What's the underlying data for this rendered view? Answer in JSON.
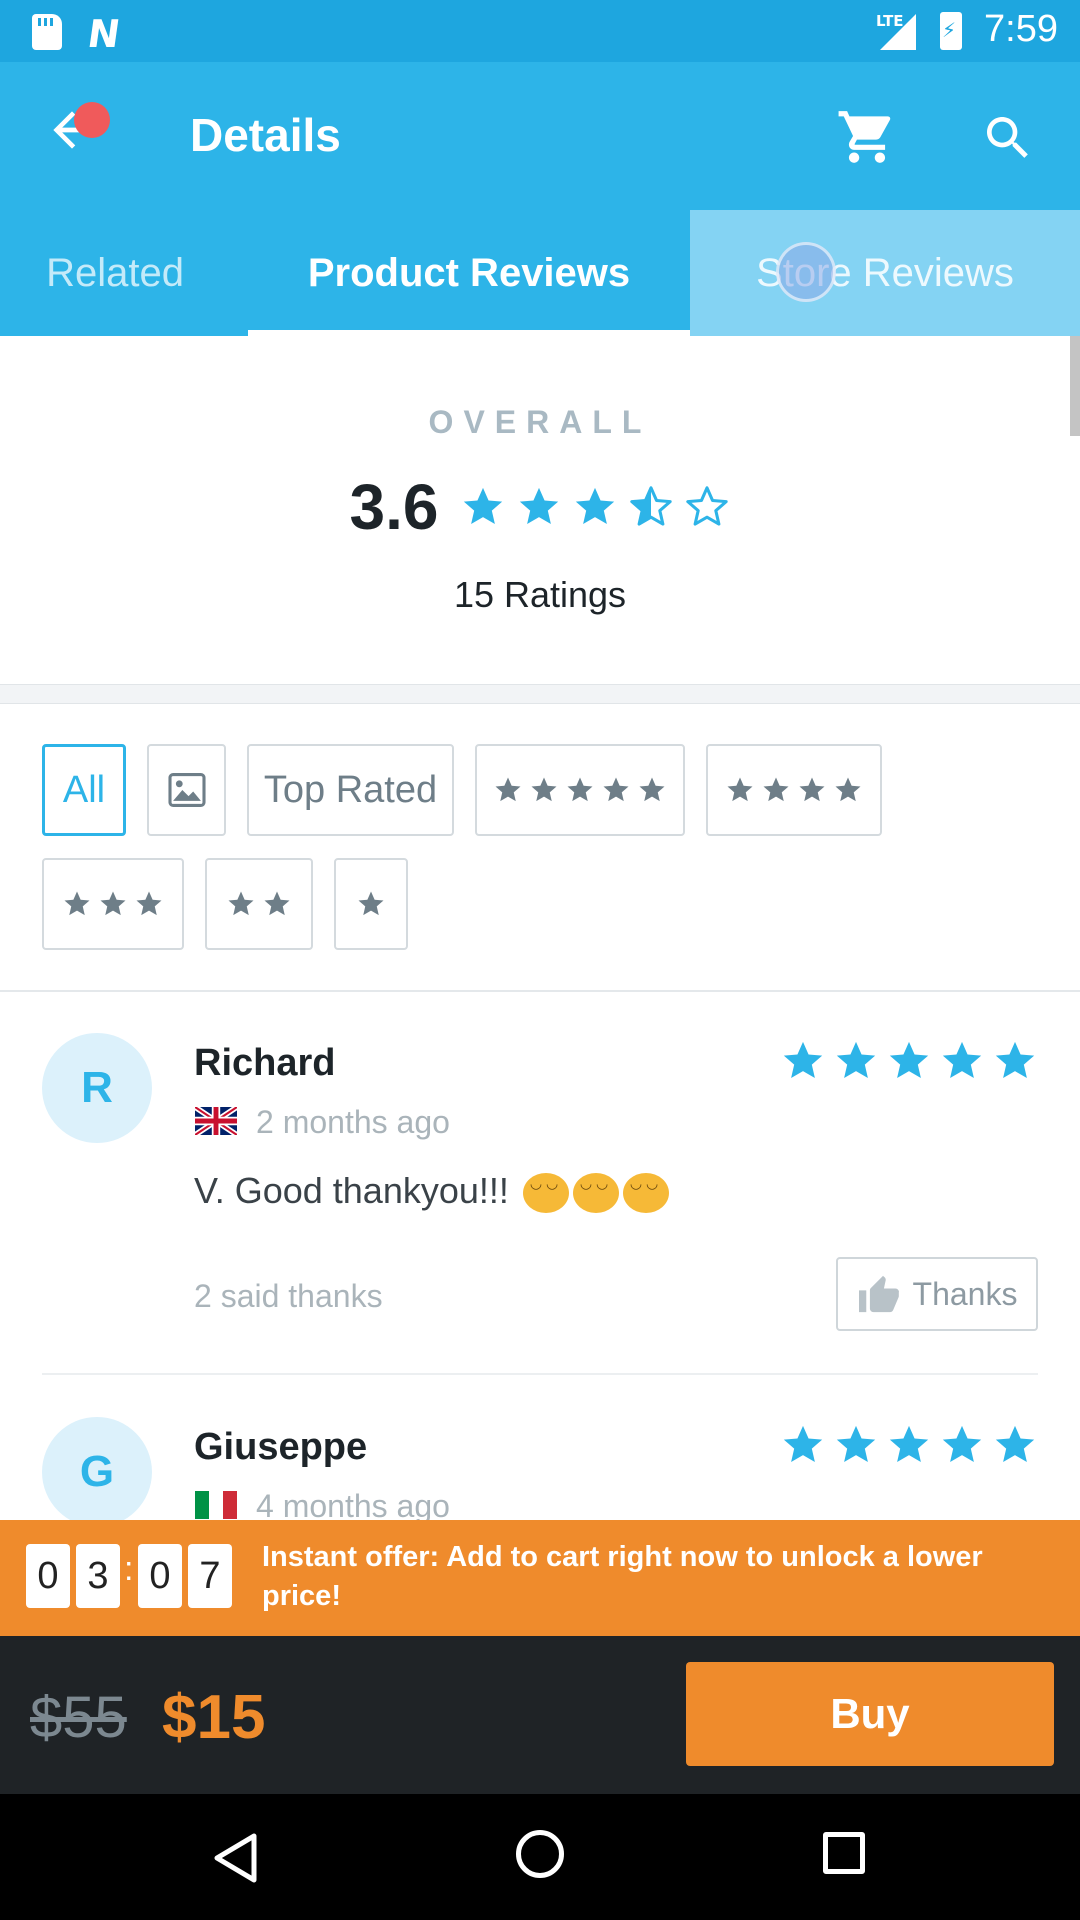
{
  "status_bar": {
    "network": "LTE",
    "time": "7:59"
  },
  "app_bar": {
    "title": "Details"
  },
  "tabs": [
    {
      "label": "Related",
      "active": false
    },
    {
      "label": "Product Reviews",
      "active": true
    },
    {
      "label": "Store Reviews",
      "active": false
    }
  ],
  "overall": {
    "label": "OVERALL",
    "score": "3.6",
    "stars": 3.5,
    "ratings_count": "15 Ratings"
  },
  "filters": {
    "all": "All",
    "image_icon": "image-icon",
    "top_rated": "Top Rated",
    "star_filters": [
      5,
      4,
      3,
      2,
      1
    ]
  },
  "reviews": [
    {
      "initial": "R",
      "name": "Richard",
      "stars": 5,
      "country_flag": "uk-flag-icon",
      "date": "2 months ago",
      "text": "V. Good thankyou!!!",
      "emoji_count": 3,
      "thanks_count": "2 said thanks",
      "thanks_label": "Thanks"
    },
    {
      "initial": "G",
      "name": "Giuseppe",
      "stars": 5,
      "country_flag": "italy-flag-icon",
      "date": "4 months ago"
    }
  ],
  "offer": {
    "timer": [
      "0",
      "3",
      "0",
      "7"
    ],
    "separator": ":",
    "text": "Instant offer: Add to cart right now to unlock a lower price!"
  },
  "price": {
    "original": "$55",
    "current": "$15",
    "buy_label": "Buy"
  },
  "colors": {
    "primary": "#2db4e8",
    "status_bar": "#1ea6df",
    "accent": "#ef8b2c",
    "dark": "#1f2326",
    "star": "#2db4e8"
  }
}
